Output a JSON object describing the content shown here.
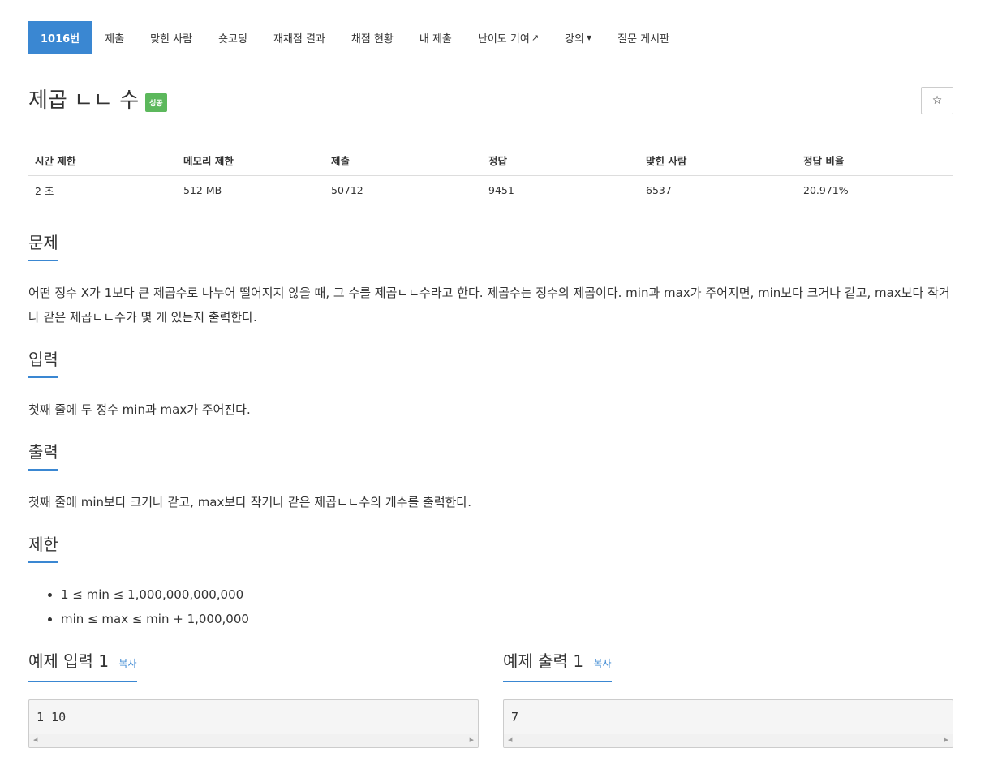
{
  "nav": {
    "items": [
      {
        "label": "1016번"
      },
      {
        "label": "제출"
      },
      {
        "label": "맞힌 사람"
      },
      {
        "label": "숏코딩"
      },
      {
        "label": "재채점 결과"
      },
      {
        "label": "채점 현황"
      },
      {
        "label": "내 제출"
      },
      {
        "label": "난이도 기여"
      },
      {
        "label": "강의"
      },
      {
        "label": "질문 게시판"
      }
    ],
    "ext_icon": "external-link-icon",
    "caret_icon": "caret-down-icon"
  },
  "problem": {
    "title": "제곱 ㄴㄴ 수",
    "badge": "성공",
    "star_icon": "star-icon"
  },
  "info_table": {
    "headers": [
      "시간 제한",
      "메모리 제한",
      "제출",
      "정답",
      "맞힌 사람",
      "정답 비율"
    ],
    "values": [
      "2 초",
      "512 MB",
      "50712",
      "9451",
      "6537",
      "20.971%"
    ]
  },
  "sections": {
    "problem_title": "문제",
    "problem_text": "어떤 정수 X가 1보다 큰 제곱수로 나누어 떨어지지 않을 때, 그 수를 제곱ㄴㄴ수라고 한다. 제곱수는 정수의 제곱이다. min과 max가 주어지면, min보다 크거나 같고, max보다 작거나 같은 제곱ㄴㄴ수가 몇 개 있는지 출력한다.",
    "input_title": "입력",
    "input_text": "첫째 줄에 두 정수 min과 max가 주어진다.",
    "output_title": "출력",
    "output_text": "첫째 줄에 min보다 크거나 같고, max보다 작거나 같은 제곱ㄴㄴ수의 개수를 출력한다.",
    "limit_title": "제한",
    "limits": [
      "1 ≤ min ≤ 1,000,000,000,000",
      "min ≤ max ≤ min + 1,000,000"
    ]
  },
  "examples": {
    "input_title": "예제 입력 1",
    "output_title": "예제 출력 1",
    "copy_label": "복사",
    "input_code": "1 10",
    "output_code": "7"
  }
}
